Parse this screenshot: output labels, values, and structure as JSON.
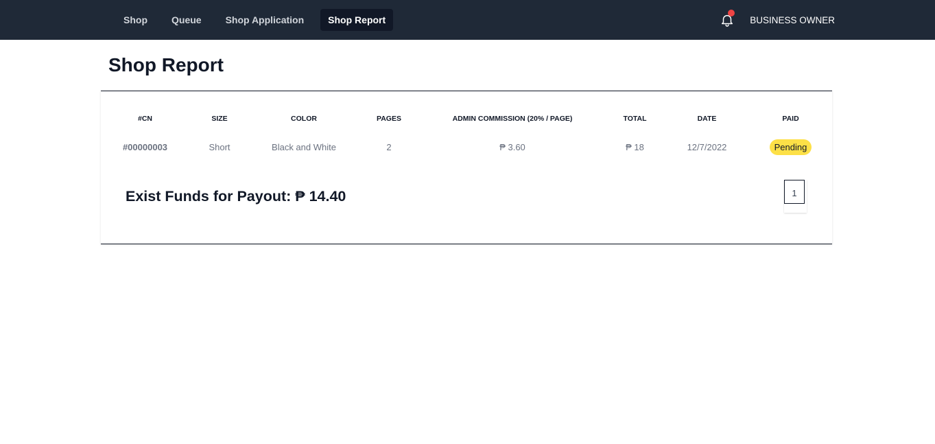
{
  "nav": {
    "links": [
      {
        "label": "Shop"
      },
      {
        "label": "Queue"
      },
      {
        "label": "Shop Application"
      },
      {
        "label": "Shop Report",
        "active": true
      }
    ],
    "user": "BUSINESS OWNER",
    "icons": {
      "notification": "bell-icon"
    }
  },
  "page": {
    "title": "Shop Report"
  },
  "table": {
    "headers": [
      "#CN",
      "SIZE",
      "COLOR",
      "PAGES",
      "ADMIN COMMISSION (20% / PAGE)",
      "TOTAL",
      "DATE",
      "PAID"
    ],
    "rows": [
      {
        "cn": "#00000003",
        "size": "Short",
        "color": "Black and White",
        "pages": "2",
        "commission": "₱ 3.60",
        "total": "₱ 18",
        "date": "12/7/2022",
        "paid": "Pending"
      }
    ]
  },
  "summary": {
    "funds": "Exist Funds for Payout: ₱ 14.40"
  },
  "pagination": {
    "current": "1"
  },
  "colors": {
    "navbar": "#1f2937",
    "active_tab": "#111827",
    "notification_dot": "#ef4444",
    "pending_badge": "#fde047"
  }
}
